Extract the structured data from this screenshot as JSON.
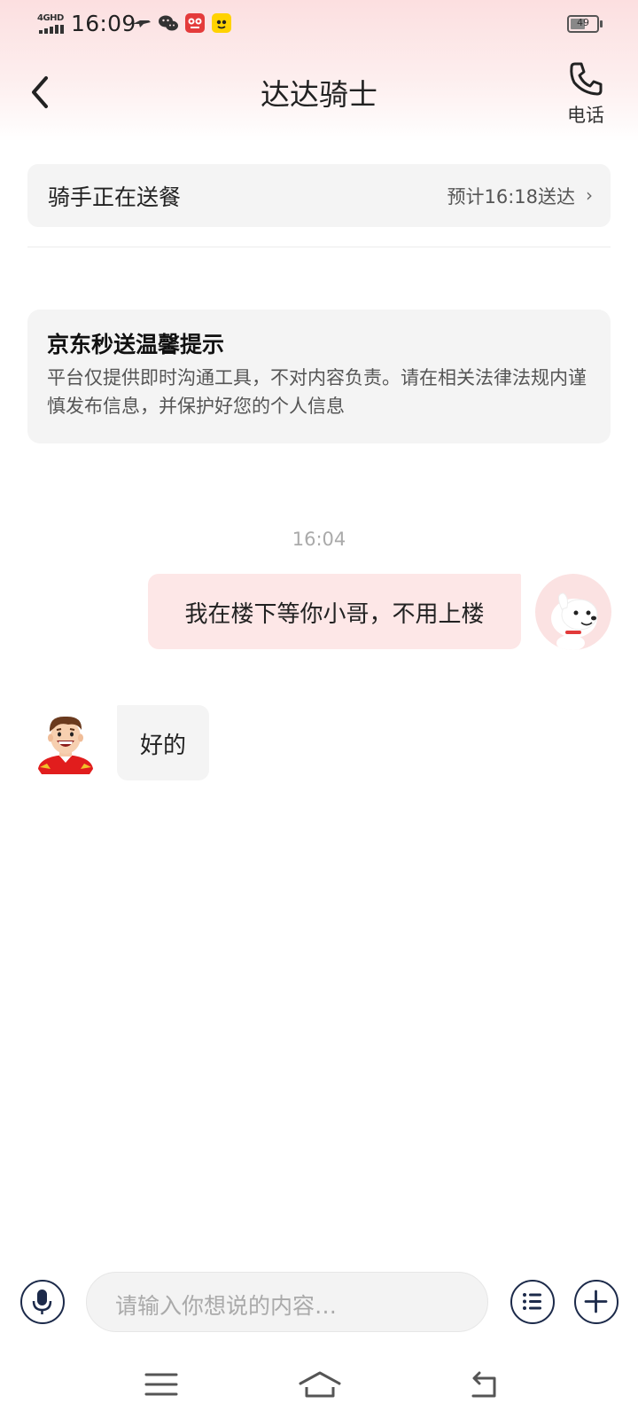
{
  "status_bar": {
    "network": "4GHD",
    "time": "16:09",
    "battery": "49",
    "icons": [
      "speedboat-icon",
      "wechat-icon",
      "taobao-icon",
      "meituan-icon"
    ]
  },
  "header": {
    "title": "达达骑士",
    "phone_label": "电话",
    "icons": {
      "back": "chevron-left-icon",
      "phone": "phone-icon"
    }
  },
  "delivery": {
    "status": "骑手正在送餐",
    "eta": "预计16:18送达",
    "chevron": "›"
  },
  "notice": {
    "title": "京东秒送温馨提示",
    "body": "平台仅提供即时沟通工具，不对内容负责。请在相关法律法规内谨慎发布信息，并保护好您的个人信息"
  },
  "chat": {
    "timestamp": "16:04",
    "messages": [
      {
        "from": "me",
        "text": "我在楼下等你小哥，不用上楼"
      },
      {
        "from": "rider",
        "text": "好的"
      }
    ]
  },
  "input_bar": {
    "placeholder": "请输入你想说的内容…",
    "icons": [
      "microphone-icon",
      "list-icon",
      "plus-icon"
    ]
  },
  "system_nav": {
    "icons": [
      "menu-icon",
      "home-icon",
      "back-icon"
    ]
  },
  "colors": {
    "header_tint": "#fcdfe0",
    "outgoing_bubble": "#fde7e7",
    "incoming_bubble": "#f4f4f4",
    "icon_navy": "#1c2a4a"
  }
}
